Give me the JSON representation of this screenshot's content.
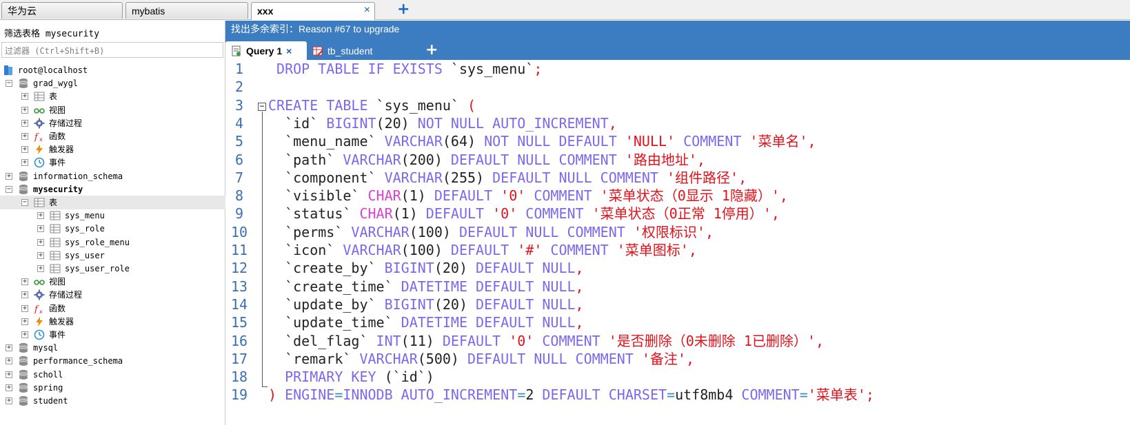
{
  "conn_tabs": [
    {
      "label": "华为云",
      "active": false
    },
    {
      "label": "mybatis",
      "active": false
    },
    {
      "label": "xxx",
      "active": true
    }
  ],
  "conn_tab_close": "×",
  "conn_add": "+",
  "filter": {
    "title": "筛选表格 mysecurity",
    "placeholder": "过滤器 (Ctrl+Shift+B)"
  },
  "tree": [
    {
      "label": "root@localhost",
      "level": 0,
      "icon": "server-icon",
      "expander": ""
    },
    {
      "label": "grad_wygl",
      "level": 0,
      "icon": "database-icon",
      "expander": "−"
    },
    {
      "label": "表",
      "level": 1,
      "icon": "table-folder-icon",
      "expander": "+"
    },
    {
      "label": "视图",
      "level": 1,
      "icon": "view-icon",
      "expander": "+"
    },
    {
      "label": "存储过程",
      "level": 1,
      "icon": "procedure-icon",
      "expander": "+"
    },
    {
      "label": "函数",
      "level": 1,
      "icon": "function-icon",
      "expander": "+"
    },
    {
      "label": "触发器",
      "level": 1,
      "icon": "trigger-icon",
      "expander": "+"
    },
    {
      "label": "事件",
      "level": 1,
      "icon": "event-icon",
      "expander": "+"
    },
    {
      "label": "information_schema",
      "level": 0,
      "icon": "database-icon",
      "expander": "+"
    },
    {
      "label": "mysecurity",
      "level": 0,
      "icon": "database-icon",
      "expander": "−",
      "bold": true
    },
    {
      "label": "表",
      "level": 1,
      "icon": "table-folder-icon",
      "expander": "−",
      "selected": true
    },
    {
      "label": "sys_menu",
      "level": 2,
      "icon": "table-icon",
      "expander": "+"
    },
    {
      "label": "sys_role",
      "level": 2,
      "icon": "table-icon",
      "expander": "+"
    },
    {
      "label": "sys_role_menu",
      "level": 2,
      "icon": "table-icon",
      "expander": "+"
    },
    {
      "label": "sys_user",
      "level": 2,
      "icon": "table-icon",
      "expander": "+"
    },
    {
      "label": "sys_user_role",
      "level": 2,
      "icon": "table-icon",
      "expander": "+"
    },
    {
      "label": "视图",
      "level": 1,
      "icon": "view-icon",
      "expander": "+"
    },
    {
      "label": "存储过程",
      "level": 1,
      "icon": "procedure-icon",
      "expander": "+"
    },
    {
      "label": "函数",
      "level": 1,
      "icon": "function-icon",
      "expander": "+"
    },
    {
      "label": "触发器",
      "level": 1,
      "icon": "trigger-icon",
      "expander": "+"
    },
    {
      "label": "事件",
      "level": 1,
      "icon": "event-icon",
      "expander": "+"
    },
    {
      "label": "mysql",
      "level": 0,
      "icon": "database-icon",
      "expander": "+"
    },
    {
      "label": "performance_schema",
      "level": 0,
      "icon": "database-icon",
      "expander": "+"
    },
    {
      "label": "scholl",
      "level": 0,
      "icon": "database-icon",
      "expander": "+"
    },
    {
      "label": "spring",
      "level": 0,
      "icon": "database-icon",
      "expander": "+"
    },
    {
      "label": "student",
      "level": 0,
      "icon": "database-icon",
      "expander": "+"
    }
  ],
  "banner": "找出多余索引：Reason #67 to upgrade",
  "query_tabs": [
    {
      "label": "Query 1",
      "active": true,
      "icon": "query-icon",
      "close": "×"
    },
    {
      "label": "tb_student",
      "active": false,
      "icon": "table-edit-icon",
      "close": ""
    }
  ],
  "query_add": "+",
  "editor_lines": [
    [
      [
        "kw",
        " DROP TABLE IF EXISTS "
      ],
      [
        "id",
        "`sys_menu`"
      ],
      [
        "pun",
        ";"
      ]
    ],
    [],
    [
      [
        "kw",
        "CREATE TABLE "
      ],
      [
        "id",
        "`sys_menu`"
      ],
      [
        "pun",
        " ("
      ]
    ],
    [
      [
        "id",
        "  `id` "
      ],
      [
        "ty",
        "BIGINT"
      ],
      [
        "id",
        "(20) "
      ],
      [
        "kw",
        "NOT NULL AUTO_INCREMENT"
      ],
      [
        "pun",
        ","
      ]
    ],
    [
      [
        "id",
        "  `menu_name` "
      ],
      [
        "ty",
        "VARCHAR"
      ],
      [
        "id",
        "(64) "
      ],
      [
        "kw",
        "NOT NULL DEFAULT "
      ],
      [
        "str",
        "'NULL'"
      ],
      [
        "kw",
        " COMMENT "
      ],
      [
        "str",
        "'菜单名'"
      ],
      [
        "pun",
        ","
      ]
    ],
    [
      [
        "id",
        "  `path` "
      ],
      [
        "ty",
        "VARCHAR"
      ],
      [
        "id",
        "(200) "
      ],
      [
        "kw",
        "DEFAULT NULL COMMENT "
      ],
      [
        "str",
        "'路由地址'"
      ],
      [
        "pun",
        ","
      ]
    ],
    [
      [
        "id",
        "  `component` "
      ],
      [
        "ty",
        "VARCHAR"
      ],
      [
        "id",
        "(255) "
      ],
      [
        "kw",
        "DEFAULT NULL COMMENT "
      ],
      [
        "str",
        "'组件路径'"
      ],
      [
        "pun",
        ","
      ]
    ],
    [
      [
        "id",
        "  `visible` "
      ],
      [
        "ch",
        "CHAR"
      ],
      [
        "id",
        "(1) "
      ],
      [
        "kw",
        "DEFAULT "
      ],
      [
        "str",
        "'0'"
      ],
      [
        "kw",
        " COMMENT "
      ],
      [
        "str",
        "'菜单状态（0显示 1隐藏）'"
      ],
      [
        "pun",
        ","
      ]
    ],
    [
      [
        "id",
        "  `status` "
      ],
      [
        "ch",
        "CHAR"
      ],
      [
        "id",
        "(1) "
      ],
      [
        "kw",
        "DEFAULT "
      ],
      [
        "str",
        "'0'"
      ],
      [
        "kw",
        " COMMENT "
      ],
      [
        "str",
        "'菜单状态（0正常 1停用）'"
      ],
      [
        "pun",
        ","
      ]
    ],
    [
      [
        "id",
        "  `perms` "
      ],
      [
        "ty",
        "VARCHAR"
      ],
      [
        "id",
        "(100) "
      ],
      [
        "kw",
        "DEFAULT NULL COMMENT "
      ],
      [
        "str",
        "'权限标识'"
      ],
      [
        "pun",
        ","
      ]
    ],
    [
      [
        "id",
        "  `icon` "
      ],
      [
        "ty",
        "VARCHAR"
      ],
      [
        "id",
        "(100) "
      ],
      [
        "kw",
        "DEFAULT "
      ],
      [
        "str",
        "'#'"
      ],
      [
        "kw",
        " COMMENT "
      ],
      [
        "str",
        "'菜单图标'"
      ],
      [
        "pun",
        ","
      ]
    ],
    [
      [
        "id",
        "  `create_by` "
      ],
      [
        "ty",
        "BIGINT"
      ],
      [
        "id",
        "(20) "
      ],
      [
        "kw",
        "DEFAULT NULL"
      ],
      [
        "pun",
        ","
      ]
    ],
    [
      [
        "id",
        "  `create_time` "
      ],
      [
        "ty",
        "DATETIME"
      ],
      [
        "kw",
        " DEFAULT NULL"
      ],
      [
        "pun",
        ","
      ]
    ],
    [
      [
        "id",
        "  `update_by` "
      ],
      [
        "ty",
        "BIGINT"
      ],
      [
        "id",
        "(20) "
      ],
      [
        "kw",
        "DEFAULT NULL"
      ],
      [
        "pun",
        ","
      ]
    ],
    [
      [
        "id",
        "  `update_time` "
      ],
      [
        "ty",
        "DATETIME"
      ],
      [
        "kw",
        " DEFAULT NULL"
      ],
      [
        "pun",
        ","
      ]
    ],
    [
      [
        "id",
        "  `del_flag` "
      ],
      [
        "ty",
        "INT"
      ],
      [
        "id",
        "(11) "
      ],
      [
        "kw",
        "DEFAULT "
      ],
      [
        "str",
        "'0'"
      ],
      [
        "kw",
        " COMMENT "
      ],
      [
        "str",
        "'是否删除（0未删除 1已删除）'"
      ],
      [
        "pun",
        ","
      ]
    ],
    [
      [
        "id",
        "  `remark` "
      ],
      [
        "ty",
        "VARCHAR"
      ],
      [
        "id",
        "(500) "
      ],
      [
        "kw",
        "DEFAULT NULL COMMENT "
      ],
      [
        "str",
        "'备注'"
      ],
      [
        "pun",
        ","
      ]
    ],
    [
      [
        "kw",
        "  PRIMARY KEY "
      ],
      [
        "id",
        "(`id`)"
      ]
    ],
    [
      [
        "pun",
        ") "
      ],
      [
        "kw",
        "ENGINE"
      ],
      [
        "op",
        "="
      ],
      [
        "kw",
        "INNODB AUTO_INCREMENT"
      ],
      [
        "op",
        "="
      ],
      [
        "id",
        "2 "
      ],
      [
        "kw",
        "DEFAULT CHARSET"
      ],
      [
        "op",
        "="
      ],
      [
        "id",
        "utf8mb4 "
      ],
      [
        "kw",
        "COMMENT"
      ],
      [
        "op",
        "="
      ],
      [
        "str",
        "'菜单表'"
      ],
      [
        "pun",
        ";"
      ]
    ]
  ],
  "line_numbers": [
    "1",
    "2",
    "3",
    "4",
    "5",
    "6",
    "7",
    "8",
    "9",
    "10",
    "11",
    "12",
    "13",
    "14",
    "15",
    "16",
    "17",
    "18",
    "19"
  ],
  "fold_marker": "−"
}
